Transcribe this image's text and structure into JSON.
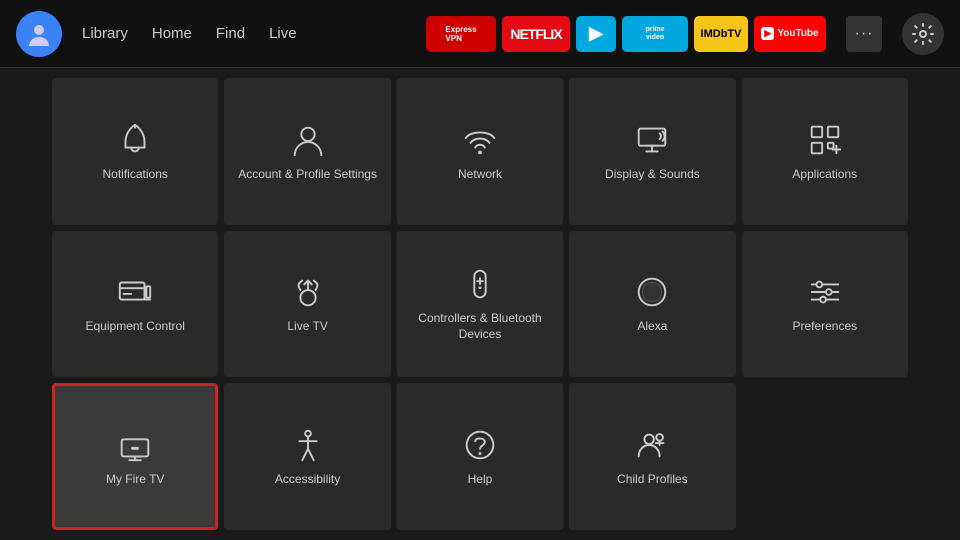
{
  "nav": {
    "links": [
      {
        "label": "Library",
        "name": "library"
      },
      {
        "label": "Home",
        "name": "home"
      },
      {
        "label": "Find",
        "name": "find"
      },
      {
        "label": "Live",
        "name": "live"
      }
    ],
    "apps": [
      {
        "label": "ExpressVPN",
        "name": "expressvpn",
        "class": "app-expressvpn"
      },
      {
        "label": "NETFLIX",
        "name": "netflix",
        "class": "app-netflix"
      },
      {
        "label": "▶",
        "name": "freevee",
        "class": "app-freeveee"
      },
      {
        "label": "prime video",
        "name": "prime",
        "class": "app-prime"
      },
      {
        "label": "IMDbTV",
        "name": "imdb",
        "class": "app-imdb"
      },
      {
        "label": "▶ YouTube",
        "name": "youtube",
        "class": "app-youtube"
      }
    ]
  },
  "grid": {
    "items": [
      {
        "label": "Notifications",
        "name": "notifications",
        "icon": "bell",
        "selected": false
      },
      {
        "label": "Account & Profile Settings",
        "name": "account-profile",
        "icon": "person",
        "selected": false
      },
      {
        "label": "Network",
        "name": "network",
        "icon": "wifi",
        "selected": false
      },
      {
        "label": "Display & Sounds",
        "name": "display-sounds",
        "icon": "display",
        "selected": false
      },
      {
        "label": "Applications",
        "name": "applications",
        "icon": "apps",
        "selected": false
      },
      {
        "label": "Equipment Control",
        "name": "equipment-control",
        "icon": "tv",
        "selected": false
      },
      {
        "label": "Live TV",
        "name": "live-tv",
        "icon": "antenna",
        "selected": false
      },
      {
        "label": "Controllers & Bluetooth Devices",
        "name": "controllers",
        "icon": "remote",
        "selected": false
      },
      {
        "label": "Alexa",
        "name": "alexa",
        "icon": "alexa",
        "selected": false
      },
      {
        "label": "Preferences",
        "name": "preferences",
        "icon": "sliders",
        "selected": false
      },
      {
        "label": "My Fire TV",
        "name": "my-fire-tv",
        "icon": "firetv",
        "selected": true
      },
      {
        "label": "Accessibility",
        "name": "accessibility",
        "icon": "accessibility",
        "selected": false
      },
      {
        "label": "Help",
        "name": "help",
        "icon": "help",
        "selected": false
      },
      {
        "label": "Child Profiles",
        "name": "child-profiles",
        "icon": "childprofile",
        "selected": false
      }
    ]
  }
}
